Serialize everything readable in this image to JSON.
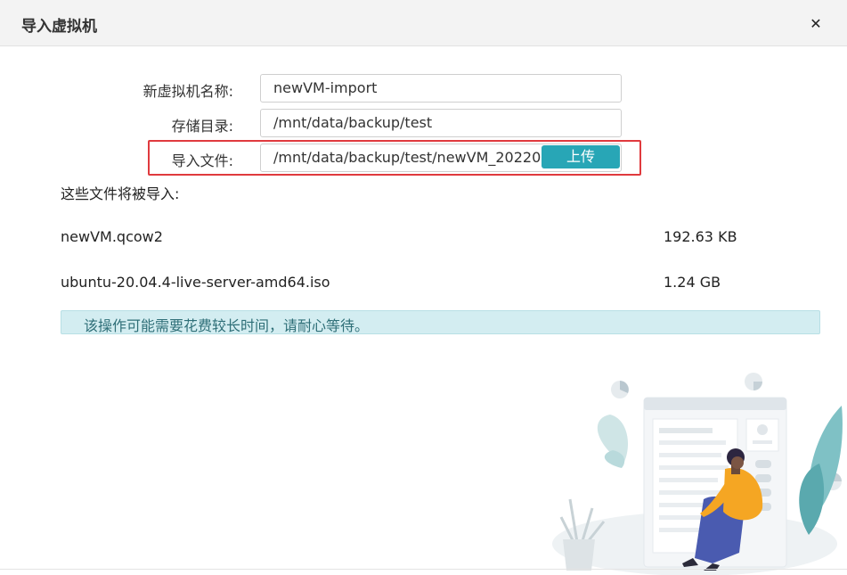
{
  "dialog": {
    "title": "导入虚拟机",
    "close_glyph": "✕"
  },
  "form": {
    "name_label": "新虚拟机名称:",
    "name_value": "newVM-import",
    "storage_label": "存储目录:",
    "storage_value": "/mnt/data/backup/test",
    "import_label": "导入文件:",
    "import_value": "/mnt/data/backup/test/newVM_20220",
    "upload_label": "上传"
  },
  "files": {
    "heading": "这些文件将被导入:",
    "items": [
      {
        "name": "newVM.qcow2",
        "size": "192.63 KB"
      },
      {
        "name": "ubuntu-20.04.4-live-server-amd64.iso",
        "size": "1.24 GB"
      }
    ]
  },
  "notice": {
    "text": "该操作可能需要花费较长时间，请耐心等待。"
  },
  "colors": {
    "accent": "#28a6b6",
    "highlight": "#e03a3e",
    "info_bg": "#d3edf1",
    "figure_jacket": "#f5a623",
    "figure_pants": "#4a5bb0"
  }
}
